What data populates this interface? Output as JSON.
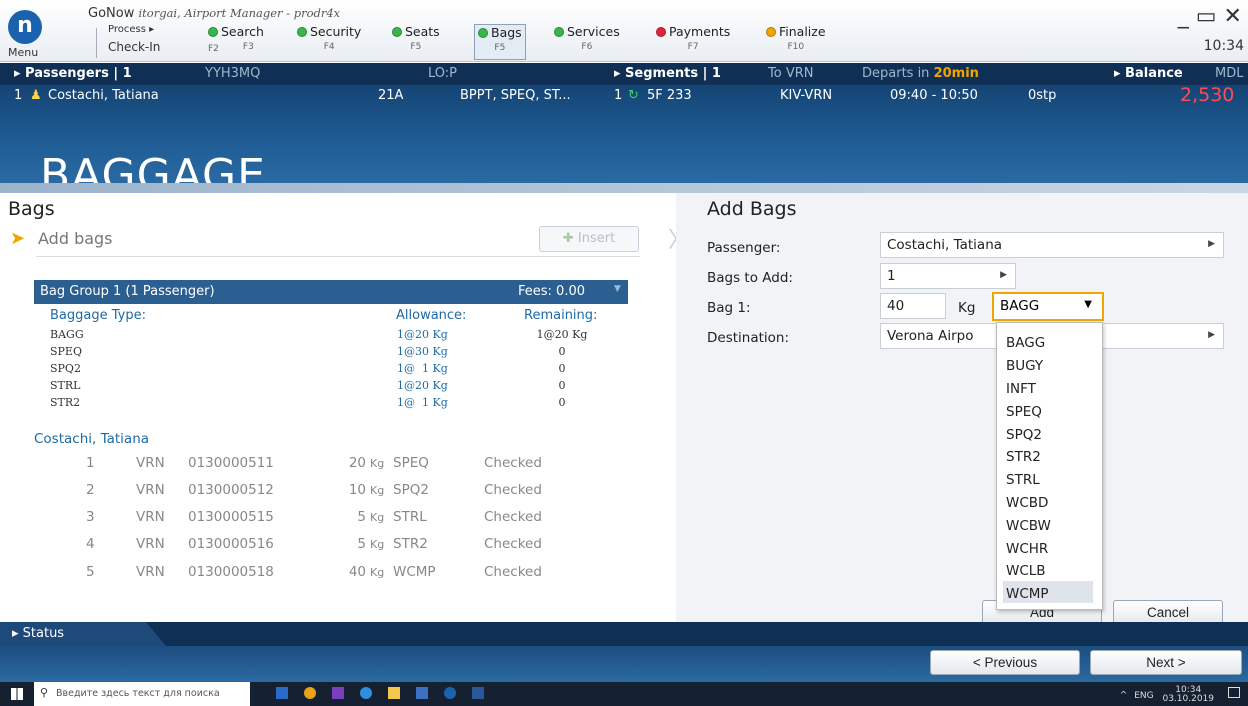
{
  "topbar": {
    "logo": "n",
    "menu_label": "Menu",
    "app_name": "GoNow",
    "app_subtitle": "itorgai, Airport Manager - prodr4x",
    "process_label": "Process ▸",
    "checkin_label": "Check-In",
    "checkin_key": "F2",
    "steps": [
      {
        "label": "Search",
        "key": "F3",
        "color": "#39b54a"
      },
      {
        "label": "Security",
        "key": "F4",
        "color": "#39b54a"
      },
      {
        "label": "Seats",
        "key": "F5",
        "color": "#39b54a"
      },
      {
        "label": "Bags",
        "key": "F5",
        "color": "#39b54a"
      },
      {
        "label": "Services",
        "key": "F6",
        "color": "#39b54a"
      },
      {
        "label": "Payments",
        "key": "F7",
        "color": "#e0243a"
      },
      {
        "label": "Finalize",
        "key": "F10",
        "color": "#f0a500"
      }
    ],
    "window_controls": "_ ▭ ✕",
    "clock": "10:34"
  },
  "info": {
    "passengers_label": "▸ Passengers | 1",
    "pnr": "YYH3MQ",
    "lo": "LO:P",
    "segments_label": "▸ Segments | 1",
    "segments_to": "To VRN",
    "departs_prefix": "Departs in",
    "departs_value": "20min",
    "balance_label": "▸ Balance",
    "balance_currency": "MDL",
    "pax_index": "1",
    "pax_name": "Costachi, Tatiana",
    "seat": "21A",
    "services": "BPPT, SPEQ, ST...",
    "seg_index": "1",
    "flight": "5F 233",
    "route": "KIV-VRN",
    "times": "09:40 - 10:50",
    "stops": "0stp",
    "balance_value": "2,530"
  },
  "page_title": "BAGGAGE",
  "left": {
    "heading": "Bags",
    "add_bags": "Add bags",
    "insert_button": "Insert",
    "bag_group_title": "Bag Group 1 (1 Passenger)",
    "fees": "Fees: 0.00",
    "col_type": "Baggage Type:",
    "col_allowance": "Allowance:",
    "col_remaining": "Remaining:",
    "types": [
      {
        "type": "BAGG",
        "allowance": "1@20 Kg",
        "remaining": "1@20 Kg"
      },
      {
        "type": "SPEQ",
        "allowance": "1@30 Kg",
        "remaining": "0"
      },
      {
        "type": "SPQ2",
        "allowance": "1@  1 Kg",
        "remaining": "0"
      },
      {
        "type": "STRL",
        "allowance": "1@20 Kg",
        "remaining": "0"
      },
      {
        "type": "STR2",
        "allowance": "1@  1 Kg",
        "remaining": "0"
      }
    ],
    "passenger_name": "Costachi, Tatiana",
    "bags": [
      {
        "n": "1",
        "dest": "VRN",
        "tag": "0130000511",
        "weight": "20",
        "unit": "Kg",
        "type": "SPEQ",
        "status": "Checked"
      },
      {
        "n": "2",
        "dest": "VRN",
        "tag": "0130000512",
        "weight": "10",
        "unit": "Kg",
        "type": "SPQ2",
        "status": "Checked"
      },
      {
        "n": "3",
        "dest": "VRN",
        "tag": "0130000515",
        "weight": "5",
        "unit": "Kg",
        "type": "STRL",
        "status": "Checked"
      },
      {
        "n": "4",
        "dest": "VRN",
        "tag": "0130000516",
        "weight": "5",
        "unit": "Kg",
        "type": "STR2",
        "status": "Checked"
      },
      {
        "n": "5",
        "dest": "VRN",
        "tag": "0130000518",
        "weight": "40",
        "unit": "Kg",
        "type": "WCMP",
        "status": "Checked"
      }
    ]
  },
  "right": {
    "heading": "Add Bags",
    "passenger_label": "Passenger:",
    "passenger_value": "Costachi, Tatiana",
    "bags_to_add_label": "Bags to Add:",
    "bags_to_add_value": "1",
    "bag1_label": "Bag 1:",
    "bag1_weight": "40",
    "bag1_unit": "Kg",
    "bag1_type": "BAGG",
    "destination_label": "Destination:",
    "destination_value": "Verona Airpo",
    "dropdown_options": [
      "BAGG",
      "BUGY",
      "INFT",
      "SPEQ",
      "SPQ2",
      "STR2",
      "STRL",
      "WCBD",
      "WCBW",
      "WCHR",
      "WCLB",
      "WCMP"
    ],
    "add_button": "Add",
    "cancel_button": "Cancel"
  },
  "status_tab": "▸ Status",
  "nav": {
    "previous": "< Previous",
    "next": "Next >"
  },
  "taskbar": {
    "search_placeholder": "Введите здесь текст для поиска",
    "lang": "ENG",
    "time": "10:34",
    "date": "03.10.2019"
  }
}
